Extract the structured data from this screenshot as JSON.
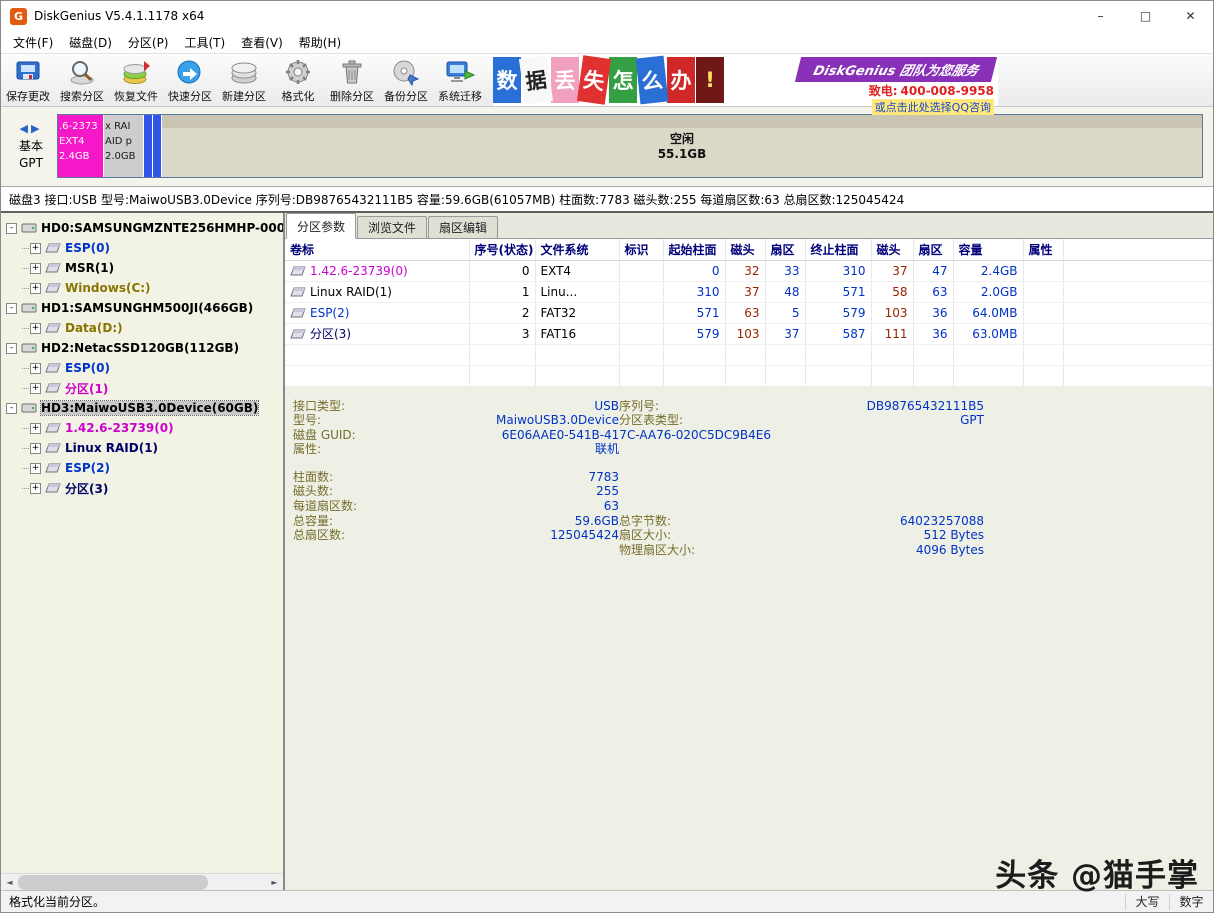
{
  "window": {
    "title": "DiskGenius V5.4.1.1178 x64",
    "controls": {
      "minimize": "–",
      "maximize": "□",
      "close": "✕"
    }
  },
  "menubar": {
    "items": [
      "文件(F)",
      "磁盘(D)",
      "分区(P)",
      "工具(T)",
      "查看(V)",
      "帮助(H)"
    ]
  },
  "toolbar": {
    "buttons": [
      {
        "label": "保存更改",
        "icon": "save-icon"
      },
      {
        "label": "搜索分区",
        "icon": "search-partition-icon"
      },
      {
        "label": "恢复文件",
        "icon": "recover-files-icon"
      },
      {
        "label": "快速分区",
        "icon": "quick-partition-icon"
      },
      {
        "label": "新建分区",
        "icon": "new-partition-icon"
      },
      {
        "label": "格式化",
        "icon": "format-icon"
      },
      {
        "label": "删除分区",
        "icon": "delete-partition-icon"
      },
      {
        "label": "备份分区",
        "icon": "backup-partition-icon"
      },
      {
        "label": "系统迁移",
        "icon": "system-migrate-icon"
      }
    ]
  },
  "banner": {
    "tiles": [
      {
        "char": "数",
        "bg": "#2a6fd6",
        "fg": "#ffffff",
        "tilt": 0
      },
      {
        "char": "据",
        "bg": "#f8f8f8",
        "fg": "#222222",
        "tilt": -8
      },
      {
        "char": "丢",
        "bg": "#f2a0c0",
        "fg": "#ffffff",
        "tilt": 0
      },
      {
        "char": "失",
        "bg": "#e03030",
        "fg": "#ffffff",
        "tilt": 8
      },
      {
        "char": "怎",
        "bg": "#35a043",
        "fg": "#ffffff",
        "tilt": 0
      },
      {
        "char": "么",
        "bg": "#2a6fd6",
        "fg": "#ffffff",
        "tilt": -6
      },
      {
        "char": "办",
        "bg": "#d02828",
        "fg": "#ffffff",
        "tilt": 0
      },
      {
        "char": "!",
        "bg": "#701818",
        "fg": "#ffe060",
        "tilt": 0
      }
    ],
    "slogan": "DiskGenius 团队为您服务",
    "slogan_bg": "#8830b8",
    "phone_label": "致电:",
    "phone": "400-008-9958",
    "phone_color": "#e02020",
    "qq": "或点击此处选择QQ咨询"
  },
  "disk_bar": {
    "nav_left": "◀",
    "nav_right": "▶",
    "type_label": "基本",
    "scheme_label": "GPT",
    "partitions": [
      {
        "name": ".6-2373",
        "fs": "EXT4",
        "size": "2.4GB",
        "color": "#f418c8",
        "text_color": "#ffffff",
        "width": 46
      },
      {
        "name": "x RAI",
        "fs": "AID p",
        "size": "2.0GB",
        "color": "#cdcdcd",
        "text_color": "#1a1a1a",
        "width": 40
      },
      {
        "name": "",
        "fs": "",
        "size": "",
        "color": "#2f55e8",
        "text_color": "#ffffff",
        "width": 9
      },
      {
        "name": "",
        "fs": "",
        "size": "",
        "color": "#2f55e8",
        "text_color": "#ffffff",
        "width": 9
      }
    ],
    "free": {
      "label": "空闲",
      "size": "55.1GB"
    }
  },
  "disk_info": {
    "text": "磁盘3 接口:USB 型号:MaiwoUSB3.0Device 序列号:DB98765432111B5 容量:59.6GB(61057MB) 柱面数:7783 磁头数:255 每道扇区数:63 总扇区数:125045424"
  },
  "tree": {
    "nodes": [
      {
        "label": "HD0:SAMSUNGMZNTE256HMHP-000",
        "level": 0,
        "expander": "-",
        "color": "#000000",
        "icon": "disk-icon",
        "selected": false
      },
      {
        "label": "ESP(0)",
        "level": 1,
        "expander": "+",
        "color": "#0033cc",
        "icon": "partition-icon",
        "selected": false
      },
      {
        "label": "MSR(1)",
        "level": 1,
        "expander": "+",
        "color": "#000000",
        "icon": "partition-icon",
        "selected": false
      },
      {
        "label": "Windows(C:)",
        "level": 1,
        "expander": "+",
        "color": "#8a7400",
        "icon": "partition-icon",
        "selected": false
      },
      {
        "label": "HD1:SAMSUNGHM500JI(466GB)",
        "level": 0,
        "expander": "-",
        "color": "#000000",
        "icon": "disk-icon",
        "selected": false
      },
      {
        "label": "Data(D:)",
        "level": 1,
        "expander": "+",
        "color": "#8a7400",
        "icon": "partition-icon",
        "selected": false
      },
      {
        "label": "HD2:NetacSSD120GB(112GB)",
        "level": 0,
        "expander": "-",
        "color": "#000000",
        "icon": "disk-icon",
        "selected": false
      },
      {
        "label": "ESP(0)",
        "level": 1,
        "expander": "+",
        "color": "#0033cc",
        "icon": "partition-icon",
        "selected": false
      },
      {
        "label": "分区(1)",
        "level": 1,
        "expander": "+",
        "color": "#cc00cc",
        "icon": "partition-icon",
        "selected": false
      },
      {
        "label": "HD3:MaiwoUSB3.0Device(60GB)",
        "level": 0,
        "expander": "-",
        "color": "#000000",
        "icon": "disk-icon",
        "selected": true
      },
      {
        "label": "1.42.6-23739(0)",
        "level": 1,
        "expander": "+",
        "color": "#cc00cc",
        "icon": "partition-icon",
        "selected": false
      },
      {
        "label": "Linux RAID(1)",
        "level": 1,
        "expander": "+",
        "color": "#000066",
        "icon": "partition-icon",
        "selected": false
      },
      {
        "label": "ESP(2)",
        "level": 1,
        "expander": "+",
        "color": "#0033cc",
        "icon": "partition-icon",
        "selected": false
      },
      {
        "label": "分区(3)",
        "level": 1,
        "expander": "+",
        "color": "#000066",
        "icon": "partition-icon",
        "selected": false
      }
    ]
  },
  "partition_table": {
    "tabs": [
      {
        "label": "分区参数",
        "name": "tab-partition-params",
        "active": true
      },
      {
        "label": "浏览文件",
        "name": "tab-browse-files",
        "active": false
      },
      {
        "label": "扇区编辑",
        "name": "tab-sector-edit",
        "active": false
      }
    ],
    "headers": [
      "卷标",
      "序号(状态)",
      "文件系统",
      "标识",
      "起始柱面",
      "磁头",
      "扇区",
      "终止柱面",
      "磁头",
      "扇区",
      "容量",
      "属性"
    ],
    "rows": [
      {
        "label": "1.42.6-23739(0)",
        "label_color": "#cc00cc",
        "cells": [
          "0",
          "EXT4",
          "",
          "0",
          "32",
          "33",
          "310",
          "37",
          "47",
          "2.4GB",
          ""
        ]
      },
      {
        "label": "Linux RAID(1)",
        "label_color": "#000000",
        "cells": [
          "1",
          "Linu...",
          "",
          "310",
          "37",
          "48",
          "571",
          "58",
          "63",
          "2.0GB",
          ""
        ]
      },
      {
        "label": "ESP(2)",
        "label_color": "#0033cc",
        "cells": [
          "2",
          "FAT32",
          "",
          "571",
          "63",
          "5",
          "579",
          "103",
          "36",
          "64.0MB",
          ""
        ]
      },
      {
        "label": "分区(3)",
        "label_color": "#000066",
        "cells": [
          "3",
          "FAT16",
          "",
          "579",
          "103",
          "37",
          "587",
          "111",
          "36",
          "63.0MB",
          ""
        ]
      }
    ],
    "number_color_blue": "#0032c8",
    "number_color_maroon": "#992400"
  },
  "details": {
    "rows": [
      {
        "l1": "接口类型:",
        "v1": "USB",
        "l2": "序列号:",
        "v2": "DB98765432111B5"
      },
      {
        "l1": "型号:",
        "v1": "MaiwoUSB3.0Device",
        "l2": "分区表类型:",
        "v2": "GPT"
      },
      {
        "l1": "磁盘 GUID:",
        "v1": "6E06AAE0-541B-417C-AA76-020C5DC9B4E6",
        "wide": true
      },
      {
        "l1": "属性:",
        "v1": "联机",
        "l2": "",
        "v2": ""
      },
      {
        "gap": true
      },
      {
        "l1": "柱面数:",
        "v1": "7783",
        "l2": "",
        "v2": ""
      },
      {
        "l1": "磁头数:",
        "v1": "255",
        "l2": "",
        "v2": ""
      },
      {
        "l1": "每道扇区数:",
        "v1": "63",
        "l2": "",
        "v2": ""
      },
      {
        "l1": "总容量:",
        "v1": "59.6GB",
        "l2": "总字节数:",
        "v2": "64023257088"
      },
      {
        "l1": "总扇区数:",
        "v1": "125045424",
        "l2": "扇区大小:",
        "v2": "512 Bytes"
      },
      {
        "l1": "",
        "v1": "",
        "l2": "物理扇区大小:",
        "v2": "4096 Bytes"
      }
    ]
  },
  "statusbar": {
    "message": "格式化当前分区。",
    "caps_label": "大写",
    "num_label": "数字"
  },
  "watermark": {
    "text": "头条 @猫手掌"
  }
}
